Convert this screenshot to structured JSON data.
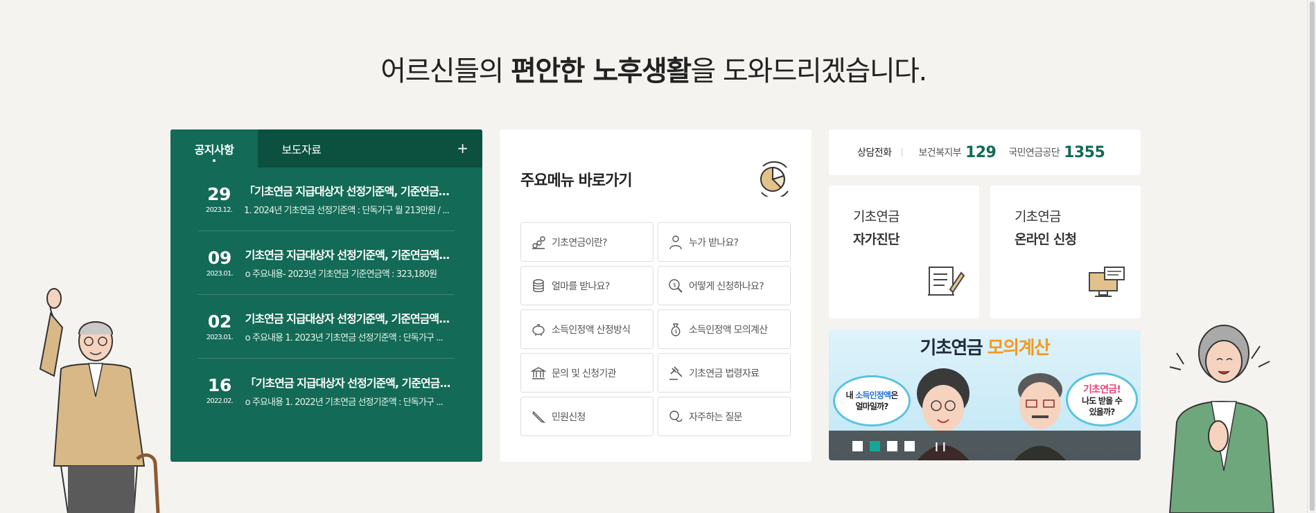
{
  "headline": {
    "pre": "어르신들의 ",
    "bold": "편안한 노후생활",
    "post": "을 도와드리겠습니다."
  },
  "notice": {
    "tabs": [
      "공지사항",
      "보도자료"
    ],
    "more": "+",
    "items": [
      {
        "day": "29",
        "ym": "2023.12.",
        "title": "「기초연금 지급대상자 선정기준액, 기준연금액...",
        "summary": "1. 2024년 기초연금 선정기준액 : 단독가구 월 213만원 / ..."
      },
      {
        "day": "09",
        "ym": "2023.01.",
        "title": "기초연금 지급대상자 선정기준액, 기준연금액...",
        "summary": "o 주요내용- 2023년 기초연금 기준연금액 : 323,180원"
      },
      {
        "day": "02",
        "ym": "2023.01.",
        "title": "기초연금 지급대상자 선정기준액, 기준연금액...",
        "summary": "o 주요내용 1. 2023년 기초연금 선정기준액 : 단독가구 ..."
      },
      {
        "day": "16",
        "ym": "2022.02.",
        "title": "「기초연금 지급대상자 선정기준액, 기준연금...",
        "summary": "o 주요내용 1. 2022년 기초연금 선정기준액 : 단독가구 ..."
      }
    ]
  },
  "menu": {
    "title_bold": "주요메뉴",
    "title_rest": " 바로가기",
    "buttons": [
      {
        "label": "기초연금이란?",
        "icon": "coins-chart-icon"
      },
      {
        "label": "누가 받나요?",
        "icon": "person-icon"
      },
      {
        "label": "얼마를 받나요?",
        "icon": "coin-stack-icon"
      },
      {
        "label": "어떻게 신청하나요?",
        "icon": "search-coin-icon"
      },
      {
        "label": "소득인정액 산정방식",
        "icon": "piggy-bank-icon"
      },
      {
        "label": "소득인정액 모의계산",
        "icon": "money-bag-icon"
      },
      {
        "label": "문의 및 신청기관",
        "icon": "bank-building-icon"
      },
      {
        "label": "기초연금 법령자료",
        "icon": "gavel-icon"
      },
      {
        "label": "민원신청",
        "icon": "pen-icon"
      },
      {
        "label": "자주하는 질문",
        "icon": "chat-bubbles-icon"
      }
    ]
  },
  "phone": {
    "label": "상담전화",
    "orgs": [
      {
        "name": "보건복지부",
        "number": "129"
      },
      {
        "name": "국민연금공단",
        "number": "1355"
      }
    ]
  },
  "cards": [
    {
      "line1": "기초연금",
      "line2": "자가진단",
      "icon": "checklist-pen-icon"
    },
    {
      "line1": "기초연금",
      "line2": "온라인 신청",
      "icon": "computer-chat-icon"
    }
  ],
  "banner": {
    "title_main": "기초연금 ",
    "title_accent": "모의계산",
    "bubble_left": {
      "line1_pre": "내 ",
      "line1_hl": "소득인정액",
      "line1_post": "은",
      "line2": "얼마일까?"
    },
    "bubble_right": {
      "line1": "기초연금!",
      "line2": "나도 받을 수",
      "line3": "있을까?"
    },
    "active_slide": 2,
    "pause": "❙❙"
  },
  "colors": {
    "primary": "#136a56",
    "dark": "#0c503f",
    "background": "#f5f3ef",
    "accent": "#f39a1e"
  }
}
